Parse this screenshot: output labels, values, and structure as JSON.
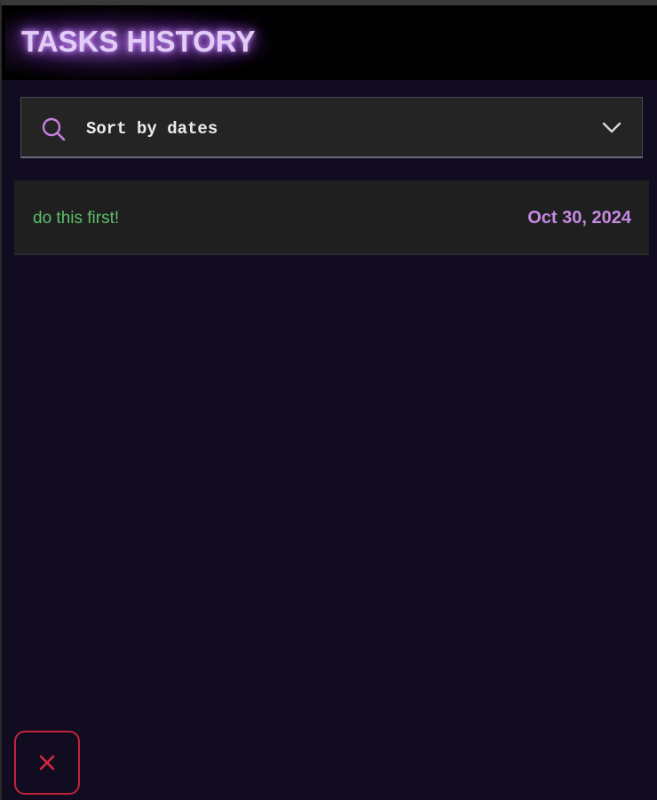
{
  "header": {
    "title": "TASKS HISTORY"
  },
  "sort": {
    "label": "Sort by dates",
    "icon_left": "search-icon",
    "icon_right": "chevron-down-icon"
  },
  "tasks": [
    {
      "name": "do this first!",
      "date": "Oct 30, 2024"
    }
  ],
  "footer": {
    "close_icon": "close-icon"
  },
  "colors": {
    "background": "#120c20",
    "header": "#000000",
    "title_glow": "#a960e6",
    "task_name": "#5dc06a",
    "task_date": "#c58ae3",
    "close_accent": "#c0243a",
    "search_icon": "#c77fe0"
  }
}
